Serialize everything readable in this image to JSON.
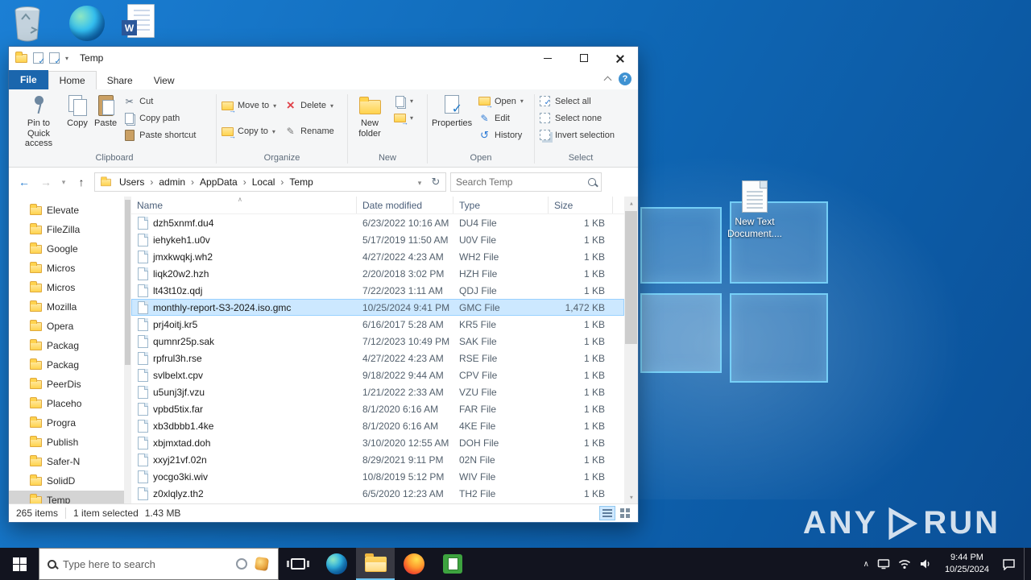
{
  "desktop": {
    "new_text_document_label": "New Text Document....",
    "watermark_left": "ANY",
    "watermark_right": "RUN"
  },
  "taskbar": {
    "search_placeholder": "Type here to search",
    "clock_time": "9:44 PM",
    "clock_date": "10/25/2024"
  },
  "window": {
    "title": "Temp",
    "help_label": "?",
    "tabs": {
      "file": "File",
      "home": "Home",
      "share": "Share",
      "view": "View"
    },
    "ribbon": {
      "pin": "Pin to Quick access",
      "copy": "Copy",
      "paste": "Paste",
      "cut": "Cut",
      "copy_path": "Copy path",
      "paste_shortcut": "Paste shortcut",
      "move_to": "Move to",
      "copy_to": "Copy to",
      "delete": "Delete",
      "rename": "Rename",
      "new_folder": "New folder",
      "properties": "Properties",
      "open": "Open",
      "edit": "Edit",
      "history": "History",
      "select_all": "Select all",
      "select_none": "Select none",
      "invert_selection": "Invert selection",
      "group_clipboard": "Clipboard",
      "group_organize": "Organize",
      "group_new": "New",
      "group_open": "Open",
      "group_select": "Select"
    },
    "address": {
      "crumbs": [
        "Users",
        "admin",
        "AppData",
        "Local",
        "Temp"
      ],
      "search_placeholder": "Search Temp"
    },
    "sidebar": [
      "Elevate",
      "FileZilla",
      "Google",
      "Micros",
      "Micros",
      "Mozilla",
      "Opera",
      "Packag",
      "Packag",
      "PeerDis",
      "Placeho",
      "Progra",
      "Publish",
      "Safer-N",
      "SolidD",
      "Temp"
    ],
    "columns": {
      "name": "Name",
      "modified": "Date modified",
      "type": "Type",
      "size": "Size"
    },
    "files": [
      {
        "name": "dzh5xnmf.du4",
        "modified": "6/23/2022 10:16 AM",
        "type": "DU4 File",
        "size": "1 KB"
      },
      {
        "name": "iehykeh1.u0v",
        "modified": "5/17/2019 11:50 AM",
        "type": "U0V File",
        "size": "1 KB"
      },
      {
        "name": "jmxkwqkj.wh2",
        "modified": "4/27/2022 4:23 AM",
        "type": "WH2 File",
        "size": "1 KB"
      },
      {
        "name": "liqk20w2.hzh",
        "modified": "2/20/2018 3:02 PM",
        "type": "HZH File",
        "size": "1 KB"
      },
      {
        "name": "lt43t10z.qdj",
        "modified": "7/22/2023 1:11 AM",
        "type": "QDJ File",
        "size": "1 KB"
      },
      {
        "name": "monthly-report-S3-2024.iso.gmc",
        "modified": "10/25/2024 9:41 PM",
        "type": "GMC File",
        "size": "1,472 KB"
      },
      {
        "name": "prj4oitj.kr5",
        "modified": "6/16/2017 5:28 AM",
        "type": "KR5 File",
        "size": "1 KB"
      },
      {
        "name": "qumnr25p.sak",
        "modified": "7/12/2023 10:49 PM",
        "type": "SAK File",
        "size": "1 KB"
      },
      {
        "name": "rpfrul3h.rse",
        "modified": "4/27/2022 4:23 AM",
        "type": "RSE File",
        "size": "1 KB"
      },
      {
        "name": "svlbelxt.cpv",
        "modified": "9/18/2022 9:44 AM",
        "type": "CPV File",
        "size": "1 KB"
      },
      {
        "name": "u5unj3jf.vzu",
        "modified": "1/21/2022 2:33 AM",
        "type": "VZU File",
        "size": "1 KB"
      },
      {
        "name": "vpbd5tix.far",
        "modified": "8/1/2020 6:16 AM",
        "type": "FAR File",
        "size": "1 KB"
      },
      {
        "name": "xb3dbbb1.4ke",
        "modified": "8/1/2020 6:16 AM",
        "type": "4KE File",
        "size": "1 KB"
      },
      {
        "name": "xbjmxtad.doh",
        "modified": "3/10/2020 12:55 AM",
        "type": "DOH File",
        "size": "1 KB"
      },
      {
        "name": "xxyj21vf.02n",
        "modified": "8/29/2021 9:11 PM",
        "type": "02N File",
        "size": "1 KB"
      },
      {
        "name": "yocgo3ki.wiv",
        "modified": "10/8/2019 5:12 PM",
        "type": "WIV File",
        "size": "1 KB"
      },
      {
        "name": "z0xlqlyz.th2",
        "modified": "6/5/2020 12:23 AM",
        "type": "TH2 File",
        "size": "1 KB"
      }
    ],
    "status": {
      "items": "265 items",
      "selected": "1 item selected",
      "size": "1.43 MB"
    }
  }
}
